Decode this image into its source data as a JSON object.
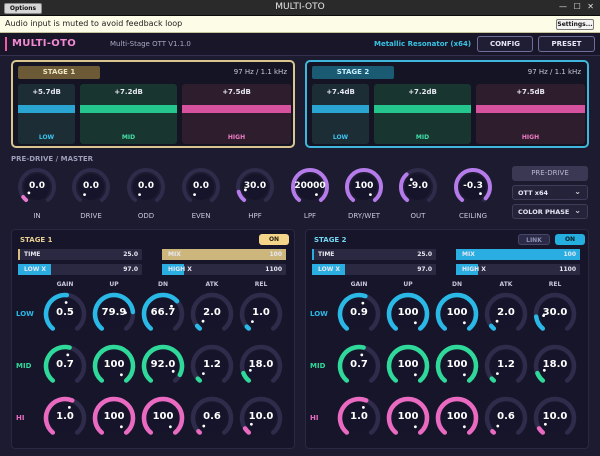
{
  "window": {
    "title": "MULTI-OTO",
    "options_label": "Options"
  },
  "notice": {
    "text": "Audio input is muted to avoid feedback loop",
    "settings_label": "Settings..."
  },
  "header": {
    "logo": "MULTI-OTO",
    "subtitle": "Multi-Stage OTT  V1.1.0",
    "preset_name": "Metallic Resonator (x64)",
    "config_label": "CONFIG",
    "preset_label": "PRESET"
  },
  "meters": [
    {
      "title": "STAGE 1",
      "freqs": "97 Hz / 1.1 kHz",
      "bands": [
        {
          "label": "LOW",
          "db": "+5.7dB"
        },
        {
          "label": "MID",
          "db": "+7.2dB"
        },
        {
          "label": "HIGH",
          "db": "+7.5dB"
        }
      ]
    },
    {
      "title": "STAGE 2",
      "freqs": "97 Hz / 1.1 kHz",
      "bands": [
        {
          "label": "LOW",
          "db": "+7.4dB"
        },
        {
          "label": "MID",
          "db": "+7.2dB"
        },
        {
          "label": "HIGH",
          "db": "+7.5dB"
        }
      ]
    }
  ],
  "predrive": {
    "title": "PRE-DRIVE / MASTER",
    "knobs": [
      {
        "label": "IN",
        "value": "0.0",
        "level": 0.05,
        "color": "#e77ad0"
      },
      {
        "label": "DRIVE",
        "value": "0.0",
        "level": 0,
        "color": "#e77ad0"
      },
      {
        "label": "ODD",
        "value": "0.0",
        "level": 0,
        "color": "#e77ad0"
      },
      {
        "label": "EVEN",
        "value": "0.0",
        "level": 0,
        "color": "#e77ad0"
      },
      {
        "label": "HPF",
        "value": "30.0",
        "level": 0.12,
        "color": "#b57bea"
      },
      {
        "label": "LPF",
        "value": "20000",
        "level": 1,
        "color": "#b57bea"
      },
      {
        "label": "DRY/WET",
        "value": "100",
        "level": 1,
        "color": "#b57bea"
      },
      {
        "label": "OUT",
        "value": "-9.0",
        "level": 0.35,
        "color": "#b57bea"
      },
      {
        "label": "CEILING",
        "value": "-0.3",
        "level": 0.97,
        "color": "#b57bea"
      }
    ],
    "predrive_button": "PRE-DRIVE",
    "mode_dropdown": "OTT x64",
    "color_dropdown": "COLOR PHASE",
    "chevron": "⌄"
  },
  "stages": [
    {
      "title": "STAGE 1",
      "on_label": "ON",
      "time": {
        "label": "TIME",
        "value": "25.0",
        "level": 0.02
      },
      "mix": {
        "label": "MIX",
        "value": "100",
        "level": 1
      },
      "lowx": {
        "label": "LOW X",
        "value": "97.0",
        "level": 0.27
      },
      "highx": {
        "label": "HIGH X",
        "value": "1100",
        "level": 0.18
      },
      "columns": [
        "GAIN",
        "UP",
        "DN",
        "ATK",
        "REL"
      ],
      "rows": [
        {
          "label": "LOW",
          "color": "#2ab9e6",
          "knobs": [
            {
              "value": "0.5",
              "level": 0.52
            },
            {
              "value": "79.9",
              "level": 0.8
            },
            {
              "value": "66.7",
              "level": 0.67
            },
            {
              "value": "2.0",
              "level": 0.04
            },
            {
              "value": "1.0",
              "level": 0.03
            }
          ]
        },
        {
          "label": "MID",
          "color": "#2fd99a",
          "knobs": [
            {
              "value": "0.7",
              "level": 0.55
            },
            {
              "value": "100",
              "level": 1
            },
            {
              "value": "92.0",
              "level": 0.92
            },
            {
              "value": "1.2",
              "level": 0.03
            },
            {
              "value": "18.0",
              "level": 0.1
            }
          ]
        },
        {
          "label": "HI",
          "color": "#ea6ac2",
          "knobs": [
            {
              "value": "1.0",
              "level": 0.58
            },
            {
              "value": "100",
              "level": 1
            },
            {
              "value": "100",
              "level": 1
            },
            {
              "value": "0.6",
              "level": 0.02
            },
            {
              "value": "10.0",
              "level": 0.06
            }
          ]
        }
      ]
    },
    {
      "title": "STAGE 2",
      "link_label": "LINK",
      "on_label": "ON",
      "time": {
        "label": "TIME",
        "value": "25.0",
        "level": 0.02
      },
      "mix": {
        "label": "MIX",
        "value": "100",
        "level": 1
      },
      "lowx": {
        "label": "LOW X",
        "value": "97.0",
        "level": 0.27
      },
      "highx": {
        "label": "HIGH X",
        "value": "1100",
        "level": 0.18
      },
      "columns": [
        "GAIN",
        "UP",
        "DN",
        "ATK",
        "REL"
      ],
      "rows": [
        {
          "label": "LOW",
          "color": "#2ab9e6",
          "knobs": [
            {
              "value": "0.9",
              "level": 0.57
            },
            {
              "value": "100",
              "level": 1
            },
            {
              "value": "100",
              "level": 1
            },
            {
              "value": "2.0",
              "level": 0.04
            },
            {
              "value": "30.0",
              "level": 0.15
            }
          ]
        },
        {
          "label": "MID",
          "color": "#2fd99a",
          "knobs": [
            {
              "value": "0.7",
              "level": 0.55
            },
            {
              "value": "100",
              "level": 1
            },
            {
              "value": "100",
              "level": 1
            },
            {
              "value": "1.2",
              "level": 0.03
            },
            {
              "value": "18.0",
              "level": 0.1
            }
          ]
        },
        {
          "label": "HI",
          "color": "#ea6ac2",
          "knobs": [
            {
              "value": "1.0",
              "level": 0.58
            },
            {
              "value": "100",
              "level": 1
            },
            {
              "value": "100",
              "level": 1
            },
            {
              "value": "0.6",
              "level": 0.02
            },
            {
              "value": "10.0",
              "level": 0.06
            }
          ]
        }
      ]
    }
  ]
}
